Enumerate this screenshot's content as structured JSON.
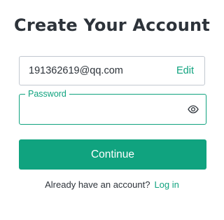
{
  "page": {
    "title": "Create Your Account"
  },
  "email": {
    "value": "191362619@qq.com",
    "edit_label": "Edit"
  },
  "password": {
    "label": "Password",
    "value": "",
    "placeholder": "",
    "toggle_icon": "eye-icon"
  },
  "actions": {
    "continue_label": "Continue"
  },
  "footer": {
    "prompt": "Already have an account?",
    "login_label": "Log in"
  },
  "colors": {
    "accent": "#10a37f",
    "text": "#2d333a",
    "border": "#c2c8d0"
  }
}
